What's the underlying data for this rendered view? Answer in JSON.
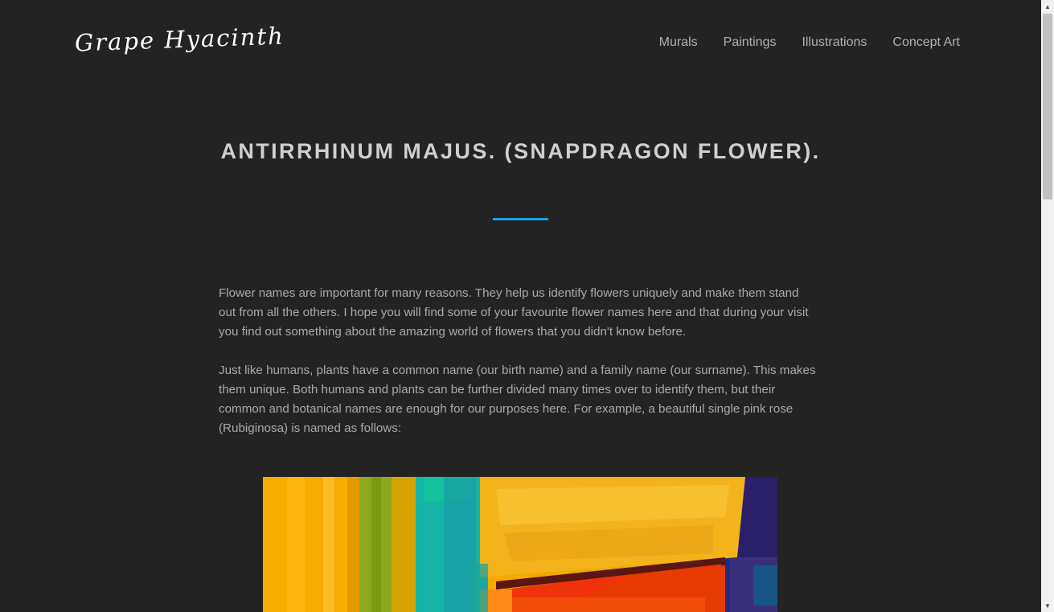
{
  "site": {
    "logo": "Grape Hyacinth"
  },
  "nav": {
    "items": [
      {
        "label": "Murals"
      },
      {
        "label": "Paintings"
      },
      {
        "label": "Illustrations"
      },
      {
        "label": "Concept Art"
      }
    ]
  },
  "article": {
    "title": "ANTIRRHINUM MAJUS. (SNAPDRAGON FLOWER).",
    "paragraphs": [
      "Flower names are important for many reasons. They help us identify flowers uniquely and make them stand out from all the others. I hope you will find some of your favourite flower names here and that during your visit you find out something about the amazing world of flowers that you didn't know before.",
      "Just like humans, plants have a common name (our birth name) and a family name (our surname). This makes them unique. Both humans and plants can be further divided many times over to identify them, but their common and botanical names are enough for our purposes here. For example, a beautiful single pink rose (Rubiginosa) is named as follows:"
    ]
  },
  "colors": {
    "background": "#232323",
    "accent": "#1ba1e2",
    "text": "#a9a9a9",
    "title": "#cfcfcf"
  },
  "icons": {
    "scroll_up": "up-arrow-icon",
    "scroll_down": "down-arrow-icon"
  }
}
